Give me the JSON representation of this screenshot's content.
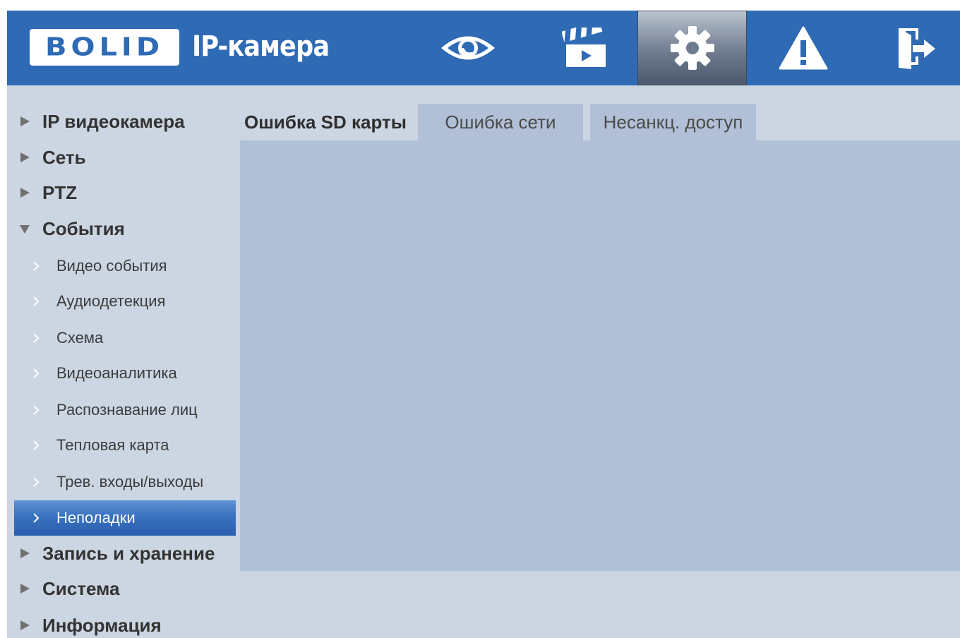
{
  "header": {
    "logo_text": "BOLID",
    "app_title": "IP-камера",
    "bg_color": "#2f6ab5",
    "nav": [
      {
        "id": "live",
        "icon": "eye-icon",
        "active": false
      },
      {
        "id": "playback",
        "icon": "clapperboard-icon",
        "active": false
      },
      {
        "id": "setup",
        "icon": "gear-icon",
        "active": true
      },
      {
        "id": "alarm",
        "icon": "warning-icon",
        "active": false
      },
      {
        "id": "logout",
        "icon": "exit-door-icon",
        "active": false
      }
    ]
  },
  "sidebar": {
    "items": [
      {
        "label": "IP видеокамера",
        "expanded": false
      },
      {
        "label": "Сеть",
        "expanded": false
      },
      {
        "label": "PTZ",
        "expanded": false
      },
      {
        "label": "События",
        "expanded": true
      },
      {
        "label": "Запись и хранение",
        "expanded": false
      },
      {
        "label": "Система",
        "expanded": false
      },
      {
        "label": "Информация",
        "expanded": false
      }
    ],
    "events_children": [
      {
        "label": "Видео события",
        "active": false
      },
      {
        "label": "Аудиодетекция",
        "active": false
      },
      {
        "label": "Схема",
        "active": false
      },
      {
        "label": "Видеоаналитика",
        "active": false
      },
      {
        "label": "Распознавание лиц",
        "active": false
      },
      {
        "label": "Тепловая карта",
        "active": false
      },
      {
        "label": "Трев. входы/выходы",
        "active": false
      },
      {
        "label": "Неполадки",
        "active": true
      }
    ]
  },
  "tabs": [
    {
      "label": "Ошибка SD карты",
      "active": true
    },
    {
      "label": "Ошибка сети",
      "active": false
    },
    {
      "label": "Несанкц. доступ",
      "active": false
    }
  ],
  "colors": {
    "accent": "#2f6ab5",
    "content_bg": "#ccd5e2",
    "panel_bg": "#b1c0d6",
    "active_item": "#3a72c0"
  }
}
